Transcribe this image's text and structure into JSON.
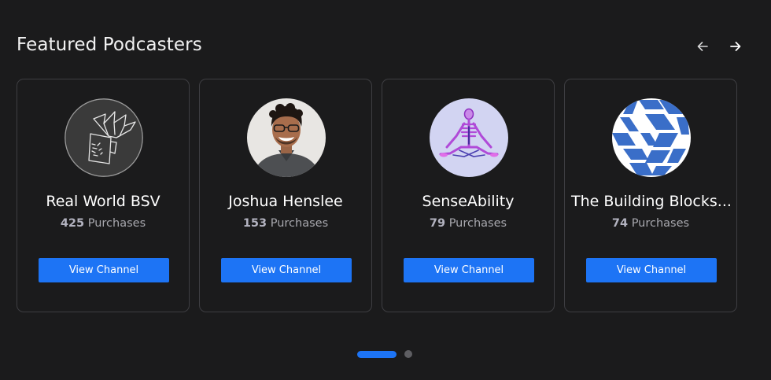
{
  "section": {
    "title": "Featured Podcasters"
  },
  "navigation": {
    "prev_icon": "arrow-left-icon",
    "next_icon": "arrow-right-icon"
  },
  "cards": [
    {
      "name": "Real World BSV",
      "purchases_count": "425",
      "purchases_label": "Purchases",
      "button_label": "View Channel",
      "avatar": "real-world-logo"
    },
    {
      "name": "Joshua Henslee",
      "purchases_count": "153",
      "purchases_label": "Purchases",
      "button_label": "View Channel",
      "avatar": "person-photo"
    },
    {
      "name": "SenseAbility",
      "purchases_count": "79",
      "purchases_label": "Purchases",
      "button_label": "View Channel",
      "avatar": "meditating-skeleton"
    },
    {
      "name": "The Building Blocks...",
      "purchases_count": "74",
      "purchases_label": "Purchases",
      "button_label": "View Channel",
      "avatar": "blue-blocks-logo"
    }
  ],
  "pagination": {
    "pages": 2,
    "active_page": 1
  },
  "colors": {
    "background": "#1b1b1c",
    "accent": "#1d74f5",
    "card_border": "#3e3e42"
  }
}
